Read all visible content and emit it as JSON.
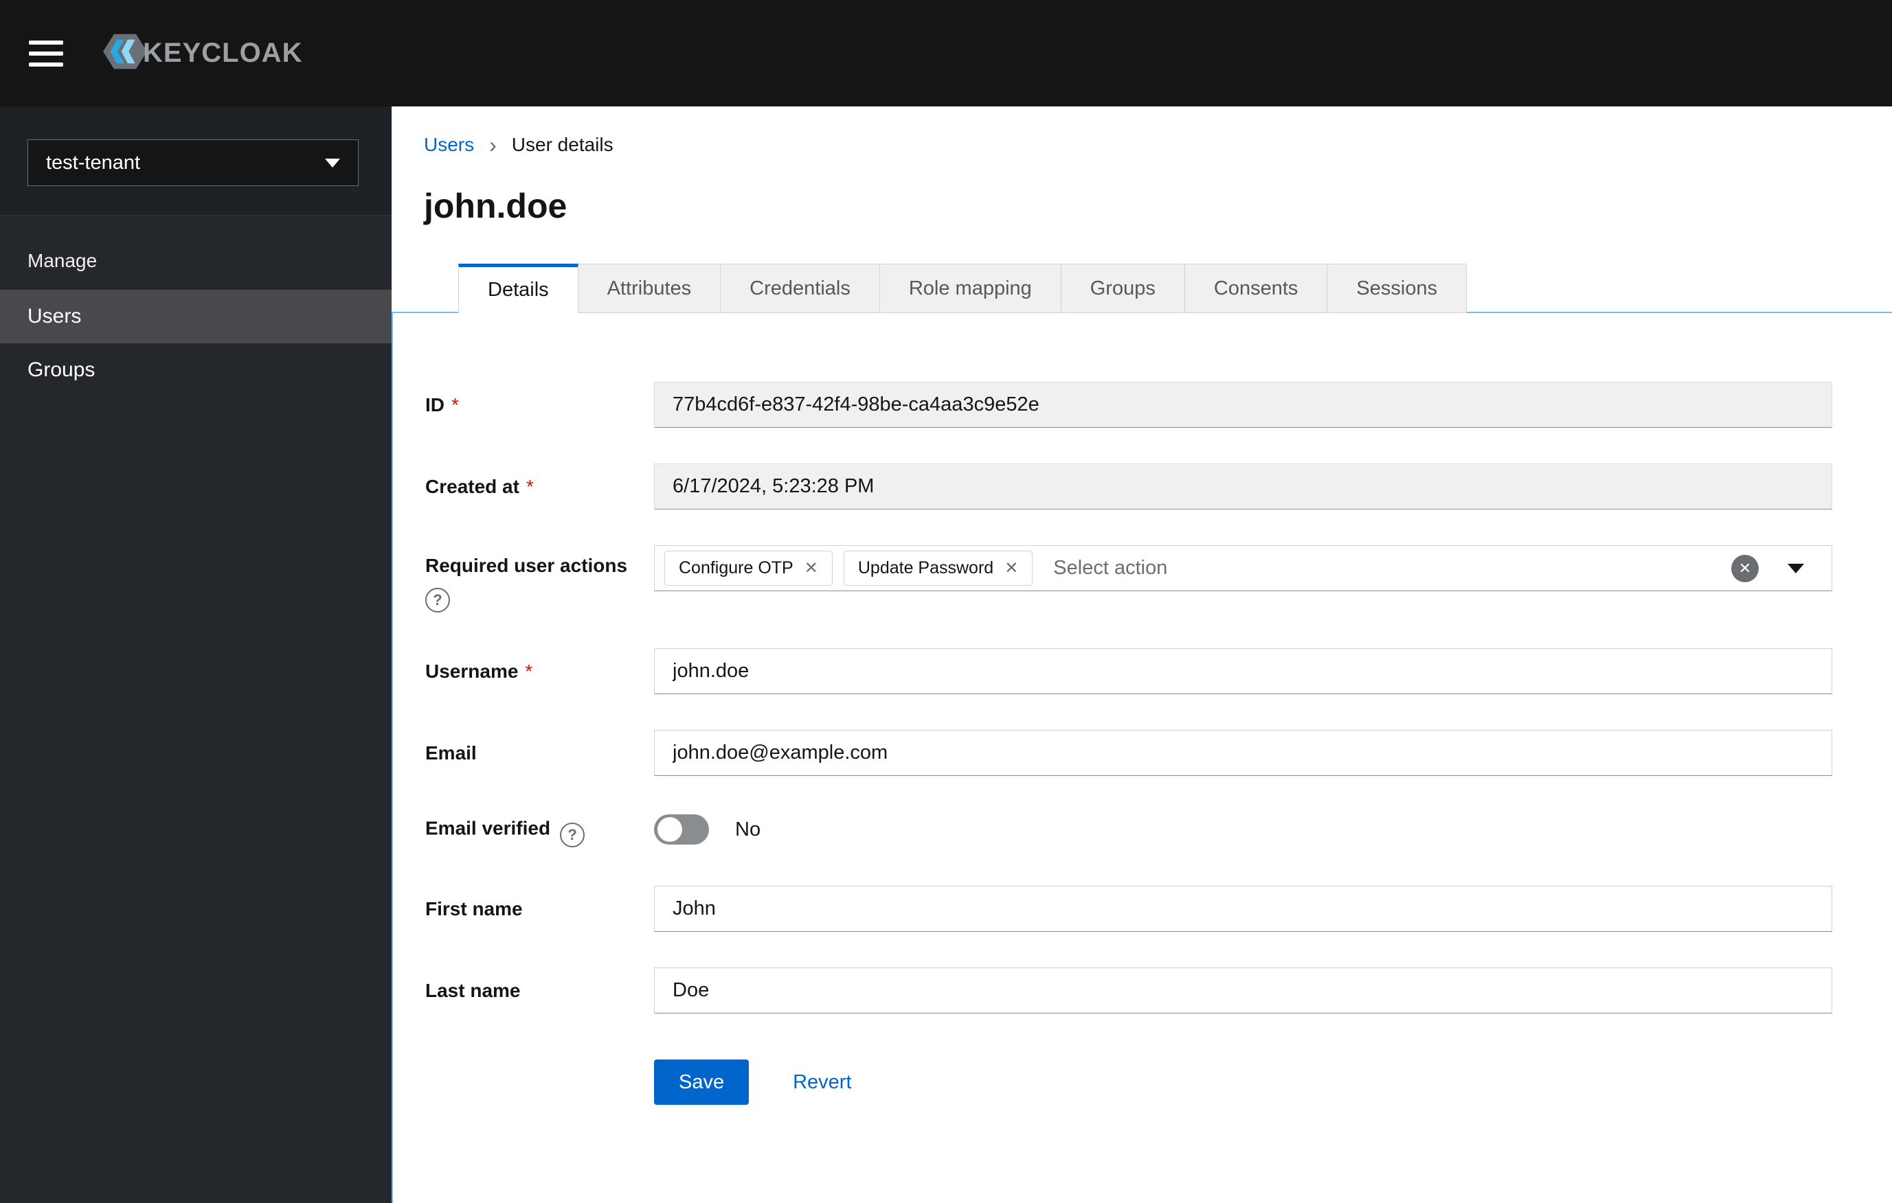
{
  "ui": {
    "required_marker": "*",
    "help_glyph": "?",
    "breadcrumb_separator": "›",
    "chip_close_glyph": "✕",
    "clear_glyph": "✕"
  },
  "colors": {
    "primary": "#0066cc",
    "topbar_background": "#151515",
    "sidebar_background": "#24272b",
    "active_nav_background": "#47494d",
    "required_asterisk": "#c9190b",
    "panel_border": "#73bcf7",
    "readonly_background": "#f0f0f0"
  },
  "topbar": {
    "brand": "KEYCLOAK"
  },
  "sidebar": {
    "realm_selector": {
      "value": "test-tenant"
    },
    "section_label": "Manage",
    "items": [
      {
        "label": "Users",
        "active": true
      },
      {
        "label": "Groups",
        "active": false
      }
    ]
  },
  "breadcrumb": {
    "items": [
      "Users",
      "User details"
    ]
  },
  "page": {
    "title": "john.doe"
  },
  "tabs": {
    "items": [
      {
        "label": "Details",
        "active": true
      },
      {
        "label": "Attributes",
        "active": false
      },
      {
        "label": "Credentials",
        "active": false
      },
      {
        "label": "Role mapping",
        "active": false
      },
      {
        "label": "Groups",
        "active": false
      },
      {
        "label": "Consents",
        "active": false
      },
      {
        "label": "Sessions",
        "active": false
      }
    ]
  },
  "form": {
    "id": {
      "label": "ID",
      "required": true,
      "readonly": true,
      "value": "77b4cd6f-e837-42f4-98be-ca4aa3c9e52e"
    },
    "created_at": {
      "label": "Created at",
      "required": true,
      "readonly": true,
      "value": "6/17/2024, 5:23:28 PM"
    },
    "required_user_actions": {
      "label": "Required user actions",
      "chips": [
        "Configure OTP",
        "Update Password"
      ],
      "placeholder": "Select action"
    },
    "username": {
      "label": "Username",
      "required": true,
      "value": "john.doe"
    },
    "email": {
      "label": "Email",
      "value": "john.doe@example.com"
    },
    "email_verified": {
      "label": "Email verified",
      "value": "No",
      "enabled": false
    },
    "first_name": {
      "label": "First name",
      "value": "John"
    },
    "last_name": {
      "label": "Last name",
      "value": "Doe"
    }
  },
  "actions": {
    "save": "Save",
    "revert": "Revert"
  }
}
